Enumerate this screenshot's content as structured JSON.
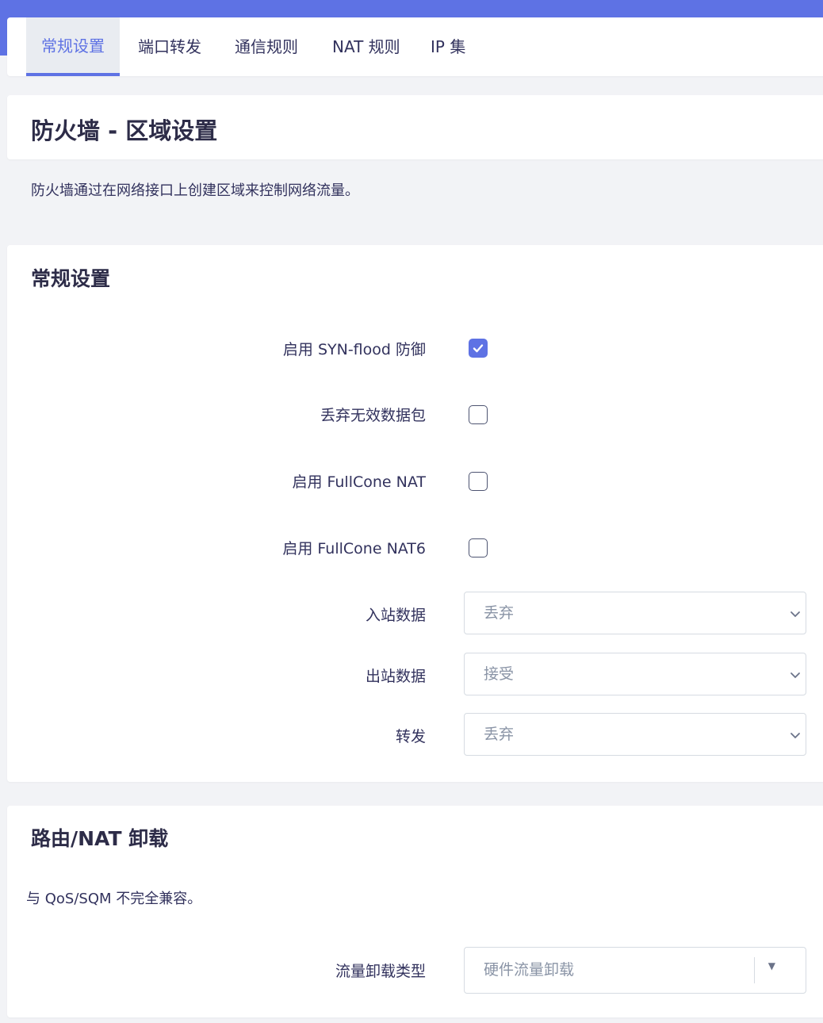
{
  "colors": {
    "accent": "#5e72e4",
    "page_bg": "#f2f3f6",
    "text": "#32325d"
  },
  "tabs": [
    {
      "label": "常规设置",
      "active": true
    },
    {
      "label": "端口转发",
      "active": false
    },
    {
      "label": "通信规则",
      "active": false
    },
    {
      "label": "NAT 规则",
      "active": false
    },
    {
      "label": "IP 集",
      "active": false
    }
  ],
  "page": {
    "title": "防火墙 - 区域设置",
    "description": "防火墙通过在网络接口上创建区域来控制网络流量。"
  },
  "general": {
    "title": "常规设置",
    "syn_flood": {
      "label": "启用 SYN-flood 防御",
      "checked": true
    },
    "drop_invalid": {
      "label": "丢弃无效数据包",
      "checked": false
    },
    "fullcone_nat": {
      "label": "启用 FullCone NAT",
      "checked": false
    },
    "fullcone_nat6": {
      "label": "启用 FullCone NAT6",
      "checked": false
    },
    "input": {
      "label": "入站数据",
      "value": "丢弃"
    },
    "output": {
      "label": "出站数据",
      "value": "接受"
    },
    "forward": {
      "label": "转发",
      "value": "丢弃"
    }
  },
  "offload": {
    "title": "路由/NAT 卸载",
    "description": "与 QoS/SQM 不完全兼容。",
    "type": {
      "label": "流量卸载类型",
      "value": "硬件流量卸载"
    }
  },
  "icons": {
    "check": "checkmark-icon",
    "chevron": "chevron-down-icon",
    "caret": "caret-down-icon"
  }
}
